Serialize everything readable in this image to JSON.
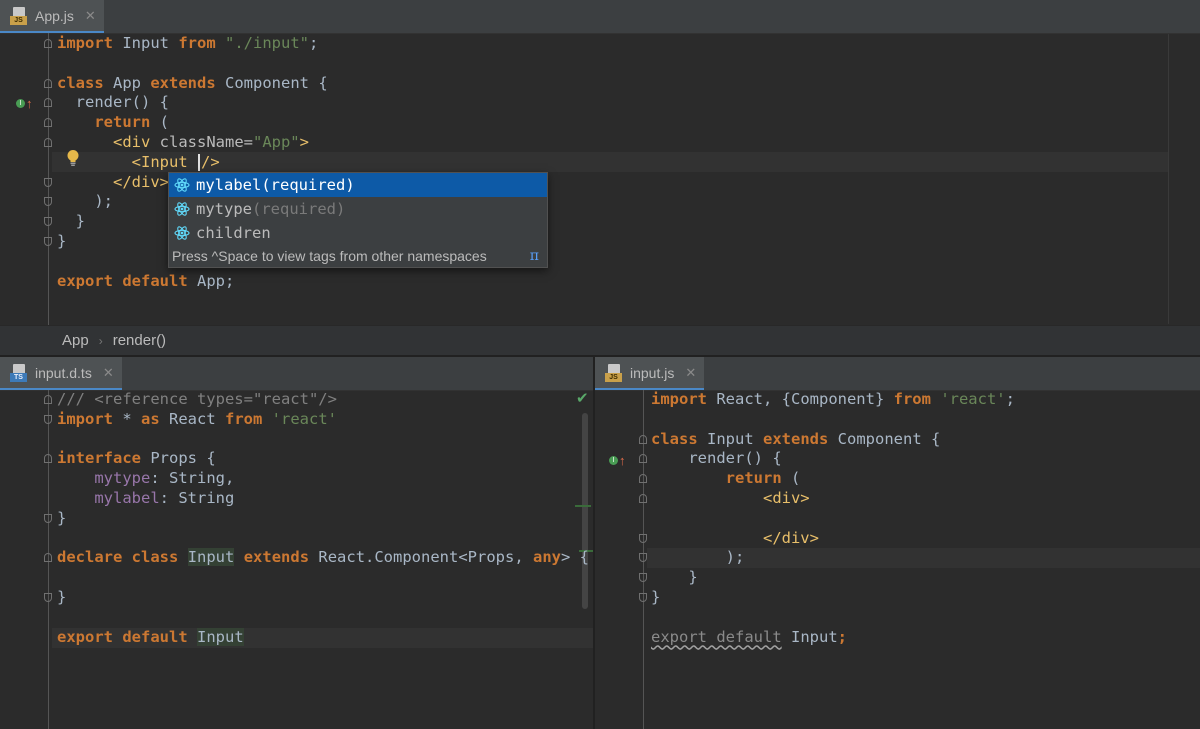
{
  "top_editor": {
    "tab": {
      "label": "App.js",
      "badge": "JS",
      "close": "✕"
    },
    "lines": [
      {
        "segs": [
          [
            "kw",
            "import"
          ],
          [
            "",
            " Input "
          ],
          [
            "kw",
            "from"
          ],
          [
            "",
            " "
          ],
          [
            "str",
            "\"./input\""
          ],
          [
            "",
            ";"
          ]
        ]
      },
      {
        "segs": []
      },
      {
        "segs": [
          [
            "kw",
            "class"
          ],
          [
            "",
            " App "
          ],
          [
            "kw",
            "extends"
          ],
          [
            "",
            " Component {"
          ]
        ]
      },
      {
        "segs": [
          [
            "",
            "  render() {"
          ]
        ]
      },
      {
        "segs": [
          [
            "",
            "    "
          ],
          [
            "kw",
            "return"
          ],
          [
            "",
            " ("
          ]
        ]
      },
      {
        "segs": [
          [
            "",
            "      "
          ],
          [
            "tag",
            "<div"
          ],
          [
            "attr",
            " className="
          ],
          [
            "str",
            "\"App\""
          ],
          [
            "tag",
            ">"
          ]
        ]
      },
      {
        "segs": [
          [
            "",
            "        "
          ],
          [
            "tag",
            "<Input "
          ]
        ]
      },
      {
        "segs": [
          [
            "",
            "      "
          ],
          [
            "tag",
            "</div>"
          ]
        ]
      },
      {
        "segs": [
          [
            "",
            "    );"
          ]
        ]
      },
      {
        "segs": [
          [
            "",
            "  }"
          ]
        ]
      },
      {
        "segs": [
          [
            "",
            "}"
          ]
        ]
      },
      {
        "segs": []
      },
      {
        "segs": [
          [
            "kw",
            "export"
          ],
          [
            "",
            " "
          ],
          [
            "kw",
            "default"
          ],
          [
            "",
            " App;"
          ]
        ]
      }
    ],
    "caret_tail": "/>",
    "completion": {
      "items": [
        {
          "name": "mylabel",
          "suffix": "(required)",
          "selected": true
        },
        {
          "name": "mytype",
          "suffix": "(required)",
          "selected": false
        },
        {
          "name": "children",
          "suffix": "",
          "selected": false
        }
      ],
      "hint": "Press ^Space to view tags from other namespaces",
      "hint_icon": "π"
    }
  },
  "breadcrumb": {
    "items": [
      "App",
      "render()"
    ],
    "separator": "›"
  },
  "left_editor": {
    "tab": {
      "label": "input.d.ts",
      "badge": "TS",
      "close": "✕"
    },
    "check": "✔",
    "lines": [
      {
        "segs": [
          [
            "cmt",
            "/// <reference types=\"react\"/>"
          ]
        ]
      },
      {
        "segs": [
          [
            "kw",
            "import"
          ],
          [
            "",
            " * "
          ],
          [
            "kw",
            "as"
          ],
          [
            "",
            " React "
          ],
          [
            "kw",
            "from"
          ],
          [
            "",
            " "
          ],
          [
            "str",
            "'react'"
          ]
        ]
      },
      {
        "segs": []
      },
      {
        "segs": [
          [
            "kw",
            "interface"
          ],
          [
            "",
            " Props {"
          ]
        ]
      },
      {
        "segs": [
          [
            "",
            "    "
          ],
          [
            "prop",
            "mytype"
          ],
          [
            "",
            ": String,"
          ]
        ]
      },
      {
        "segs": [
          [
            "",
            "    "
          ],
          [
            "prop",
            "mylabel"
          ],
          [
            "",
            ": String"
          ]
        ]
      },
      {
        "segs": [
          [
            "",
            "}"
          ]
        ]
      },
      {
        "segs": []
      },
      {
        "segs": [
          [
            "kw",
            "declare"
          ],
          [
            "",
            " "
          ],
          [
            "kw",
            "class"
          ],
          [
            "",
            " "
          ],
          [
            "hl",
            "Input"
          ],
          [
            "",
            " "
          ],
          [
            "kw",
            "extends"
          ],
          [
            "",
            " React.Component<Props, "
          ],
          [
            "kw",
            "any"
          ],
          [
            "",
            "> {"
          ]
        ]
      },
      {
        "segs": []
      },
      {
        "segs": [
          [
            "",
            "}"
          ]
        ]
      },
      {
        "segs": []
      },
      {
        "segs": [
          [
            "kw",
            "export"
          ],
          [
            "",
            " "
          ],
          [
            "kw",
            "default"
          ],
          [
            "",
            " "
          ],
          [
            "hl",
            "Input"
          ]
        ]
      }
    ]
  },
  "right_editor": {
    "tab": {
      "label": "input.js",
      "badge": "JS",
      "close": "✕"
    },
    "lines": [
      {
        "segs": [
          [
            "kw",
            "import"
          ],
          [
            "",
            " React, {Component} "
          ],
          [
            "kw",
            "from"
          ],
          [
            "",
            " "
          ],
          [
            "str",
            "'react'"
          ],
          [
            "",
            ";"
          ]
        ]
      },
      {
        "segs": []
      },
      {
        "segs": [
          [
            "kw",
            "class"
          ],
          [
            "",
            " Input "
          ],
          [
            "kw",
            "extends"
          ],
          [
            "",
            " Component {"
          ]
        ]
      },
      {
        "segs": [
          [
            "",
            "    render() {"
          ]
        ]
      },
      {
        "segs": [
          [
            "",
            "        "
          ],
          [
            "kw",
            "return"
          ],
          [
            "",
            " ("
          ]
        ]
      },
      {
        "segs": [
          [
            "",
            "            "
          ],
          [
            "tag",
            "<div>"
          ]
        ]
      },
      {
        "segs": []
      },
      {
        "segs": [
          [
            "",
            "            "
          ],
          [
            "tag",
            "</div>"
          ]
        ]
      },
      {
        "segs": [
          [
            "",
            "        );"
          ]
        ]
      },
      {
        "segs": [
          [
            "",
            "    }"
          ]
        ]
      },
      {
        "segs": [
          [
            "",
            "}"
          ]
        ]
      },
      {
        "segs": []
      },
      {
        "segs": [
          [
            "wavy",
            "export default"
          ],
          [
            "",
            " Input"
          ],
          [
            "kw",
            ";"
          ]
        ]
      }
    ]
  }
}
